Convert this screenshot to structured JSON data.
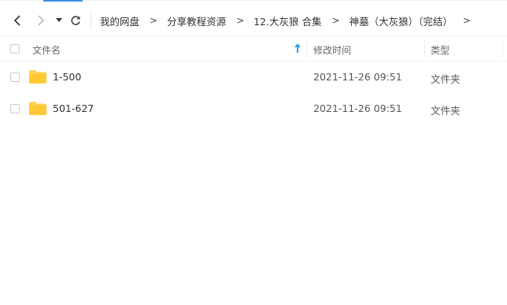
{
  "nav": {
    "back_icon": "chevron-left-icon",
    "forward_icon": "chevron-right-icon",
    "history_icon": "dropdown-caret-icon",
    "refresh_icon": "refresh-icon"
  },
  "breadcrumb": [
    {
      "label": "我的网盘"
    },
    {
      "label": "分享教程资源"
    },
    {
      "label": "12.大灰狼 合集"
    },
    {
      "label": "神墓（大灰狼）（完结）"
    }
  ],
  "breadcrumb_separator": ">",
  "columns": {
    "name": "文件名",
    "modified": "修改时间",
    "type": "类型",
    "sort_icon": "sort-ascending-icon"
  },
  "files": [
    {
      "name": "1-500",
      "modified": "2021-11-26 09:51",
      "type": "文件夹",
      "icon": "folder-icon"
    },
    {
      "name": "501-627",
      "modified": "2021-11-26 09:51",
      "type": "文件夹",
      "icon": "folder-icon"
    }
  ],
  "colors": {
    "accent": "#3a8fe0",
    "folder": "#ffd24d",
    "sort_arrow": "#2ea0ea"
  }
}
